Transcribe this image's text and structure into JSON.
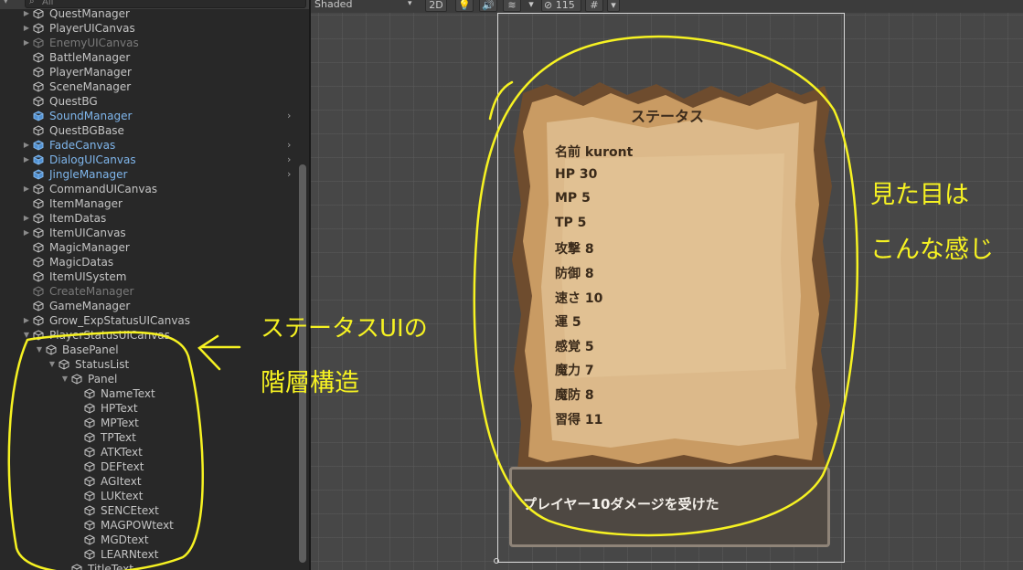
{
  "hierarchy": {
    "search_placeholder": "All",
    "menu_icon": "dropdown-icon",
    "search_icon": "search-icon",
    "items": [
      {
        "label": "QuestManager",
        "indent": 0,
        "arrow": true,
        "prefab": false,
        "inactive": false,
        "chevron": false
      },
      {
        "label": "PlayerUICanvas",
        "indent": 0,
        "arrow": true,
        "prefab": false,
        "inactive": false,
        "chevron": false
      },
      {
        "label": "EnemyUICanvas",
        "indent": 0,
        "arrow": true,
        "prefab": false,
        "inactive": true,
        "chevron": false
      },
      {
        "label": "BattleManager",
        "indent": 0,
        "arrow": false,
        "prefab": false,
        "inactive": false,
        "chevron": false
      },
      {
        "label": "PlayerManager",
        "indent": 0,
        "arrow": false,
        "prefab": false,
        "inactive": false,
        "chevron": false
      },
      {
        "label": "SceneManager",
        "indent": 0,
        "arrow": false,
        "prefab": false,
        "inactive": false,
        "chevron": false
      },
      {
        "label": "QuestBG",
        "indent": 0,
        "arrow": false,
        "prefab": false,
        "inactive": false,
        "chevron": false
      },
      {
        "label": "SoundManager",
        "indent": 0,
        "arrow": false,
        "prefab": true,
        "inactive": false,
        "chevron": true
      },
      {
        "label": "QuestBGBase",
        "indent": 0,
        "arrow": false,
        "prefab": false,
        "inactive": false,
        "chevron": false
      },
      {
        "label": "FadeCanvas",
        "indent": 0,
        "arrow": true,
        "prefab": true,
        "inactive": false,
        "chevron": true
      },
      {
        "label": "DialogUICanvas",
        "indent": 0,
        "arrow": true,
        "prefab": true,
        "inactive": false,
        "chevron": true
      },
      {
        "label": "JingleManager",
        "indent": 0,
        "arrow": false,
        "prefab": true,
        "inactive": false,
        "chevron": true
      },
      {
        "label": "CommandUICanvas",
        "indent": 0,
        "arrow": true,
        "prefab": false,
        "inactive": false,
        "chevron": false
      },
      {
        "label": "ItemManager",
        "indent": 0,
        "arrow": false,
        "prefab": false,
        "inactive": false,
        "chevron": false
      },
      {
        "label": "ItemDatas",
        "indent": 0,
        "arrow": true,
        "prefab": false,
        "inactive": false,
        "chevron": false
      },
      {
        "label": "ItemUICanvas",
        "indent": 0,
        "arrow": true,
        "prefab": false,
        "inactive": false,
        "chevron": false
      },
      {
        "label": "MagicManager",
        "indent": 0,
        "arrow": false,
        "prefab": false,
        "inactive": false,
        "chevron": false
      },
      {
        "label": "MagicDatas",
        "indent": 0,
        "arrow": false,
        "prefab": false,
        "inactive": false,
        "chevron": false
      },
      {
        "label": "ItemUISystem",
        "indent": 0,
        "arrow": false,
        "prefab": false,
        "inactive": false,
        "chevron": false
      },
      {
        "label": "CreateManager",
        "indent": 0,
        "arrow": false,
        "prefab": false,
        "inactive": true,
        "chevron": false
      },
      {
        "label": "GameManager",
        "indent": 0,
        "arrow": false,
        "prefab": false,
        "inactive": false,
        "chevron": false
      },
      {
        "label": "Grow_ExpStatusUICanvas",
        "indent": 0,
        "arrow": true,
        "prefab": false,
        "inactive": false,
        "chevron": false
      },
      {
        "label": "PlayerStatusUICanvas",
        "indent": 0,
        "arrow": true,
        "expanded": true,
        "prefab": false,
        "inactive": false,
        "chevron": false
      },
      {
        "label": "BasePanel",
        "indent": 1,
        "arrow": true,
        "expanded": true,
        "prefab": false,
        "inactive": false,
        "chevron": false
      },
      {
        "label": "StatusList",
        "indent": 2,
        "arrow": true,
        "expanded": true,
        "prefab": false,
        "inactive": false,
        "chevron": false
      },
      {
        "label": "Panel",
        "indent": 3,
        "arrow": true,
        "expanded": true,
        "prefab": false,
        "inactive": false,
        "chevron": false
      },
      {
        "label": "NameText",
        "indent": 4,
        "arrow": false,
        "prefab": false,
        "inactive": false,
        "chevron": false
      },
      {
        "label": "HPText",
        "indent": 4,
        "arrow": false,
        "prefab": false,
        "inactive": false,
        "chevron": false
      },
      {
        "label": "MPText",
        "indent": 4,
        "arrow": false,
        "prefab": false,
        "inactive": false,
        "chevron": false
      },
      {
        "label": "TPText",
        "indent": 4,
        "arrow": false,
        "prefab": false,
        "inactive": false,
        "chevron": false
      },
      {
        "label": "ATKText",
        "indent": 4,
        "arrow": false,
        "prefab": false,
        "inactive": false,
        "chevron": false
      },
      {
        "label": "DEFtext",
        "indent": 4,
        "arrow": false,
        "prefab": false,
        "inactive": false,
        "chevron": false
      },
      {
        "label": "AGItext",
        "indent": 4,
        "arrow": false,
        "prefab": false,
        "inactive": false,
        "chevron": false
      },
      {
        "label": "LUKtext",
        "indent": 4,
        "arrow": false,
        "prefab": false,
        "inactive": false,
        "chevron": false
      },
      {
        "label": "SENCEtext",
        "indent": 4,
        "arrow": false,
        "prefab": false,
        "inactive": false,
        "chevron": false
      },
      {
        "label": "MAGPOWtext",
        "indent": 4,
        "arrow": false,
        "prefab": false,
        "inactive": false,
        "chevron": false
      },
      {
        "label": "MGDtext",
        "indent": 4,
        "arrow": false,
        "prefab": false,
        "inactive": false,
        "chevron": false
      },
      {
        "label": "LEARNtext",
        "indent": 4,
        "arrow": false,
        "prefab": false,
        "inactive": false,
        "chevron": false
      },
      {
        "label": "TitleText",
        "indent": 3,
        "arrow": false,
        "prefab": false,
        "inactive": false,
        "chevron": false
      }
    ]
  },
  "scene_toolbar": {
    "shading_mode": "Shaded",
    "mode_2d": "2D",
    "lighting_icon": "light-bulb-icon",
    "audio_icon": "speaker-icon",
    "effects_icon": "layers-icon",
    "visibility_icon": "eye-slash-icon",
    "hidden_count": "115",
    "tool_icon": "grid-tool-icon",
    "dropdown_icon": "chevron-down-icon"
  },
  "game_ui": {
    "title": "ステータス",
    "stats": [
      "名前 kuront",
      "HP 30",
      "MP 5",
      "TP 5",
      "攻撃 8",
      "防御 8",
      "速さ 10",
      "運 5",
      "感覚 5",
      "魔力 7",
      "魔防 8",
      "習得 11"
    ],
    "message": "プレイヤー10ダメージを受けた",
    "parchment_color": "#dcb98a",
    "message_box_color": "#4e4842"
  },
  "annotations": {
    "left_line1": "ステータスUIの",
    "left_line2": "階層構造",
    "arrow": "←",
    "right_line1": "見た目は",
    "right_line2": "こんな感じ",
    "color": "#f6f222"
  }
}
